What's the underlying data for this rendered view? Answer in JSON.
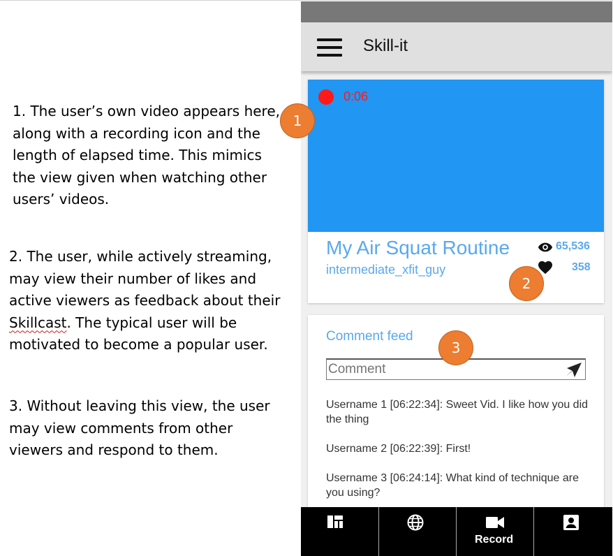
{
  "annotations": {
    "note1": "1. The user’s own video appears here, along with a recording icon and the length of elapsed time. This mimics the view given when watching other users’ videos.",
    "note2_before": "2. The user, while actively streaming, may view their number of likes and active viewers as feedback about their ",
    "note2_word": "Skillcast",
    "note2_after": ". The typical user will be motivated to become a popular user.",
    "note3": "3. Without leaving this view, the user may view comments from other viewers and respond to them."
  },
  "markers": [
    "1",
    "2",
    "3"
  ],
  "app": {
    "title": "Skill-it",
    "menu_icon": "hamburger-menu-icon"
  },
  "video": {
    "record_icon": "record-dot-icon",
    "elapsed": "0:06",
    "title": "My Air Squat Routine",
    "username": "intermediate_xfit_guy",
    "views": "65,536",
    "likes": "358",
    "colors": {
      "video_bg": "#2196f3",
      "accent": "#5aa8ee",
      "record": "#ff1a1a"
    }
  },
  "comment_feed": {
    "title": "Comment feed",
    "input_placeholder": "Comment",
    "send_icon": "send-icon",
    "comments": [
      {
        "text": "Username 1 [06:22:34]: Sweet Vid. I like how you did the thing"
      },
      {
        "text": "Username 2 [06:22:39]: First!"
      },
      {
        "text": "Username 3 [06:24:14]: What kind of technique are you using?"
      }
    ]
  },
  "navbar": {
    "items": [
      {
        "icon": "dashboard-icon",
        "label": ""
      },
      {
        "icon": "globe-icon",
        "label": ""
      },
      {
        "icon": "video-camera-icon",
        "label": "Record"
      },
      {
        "icon": "account-box-icon",
        "label": ""
      }
    ]
  },
  "marker_color": "#ed7d31"
}
